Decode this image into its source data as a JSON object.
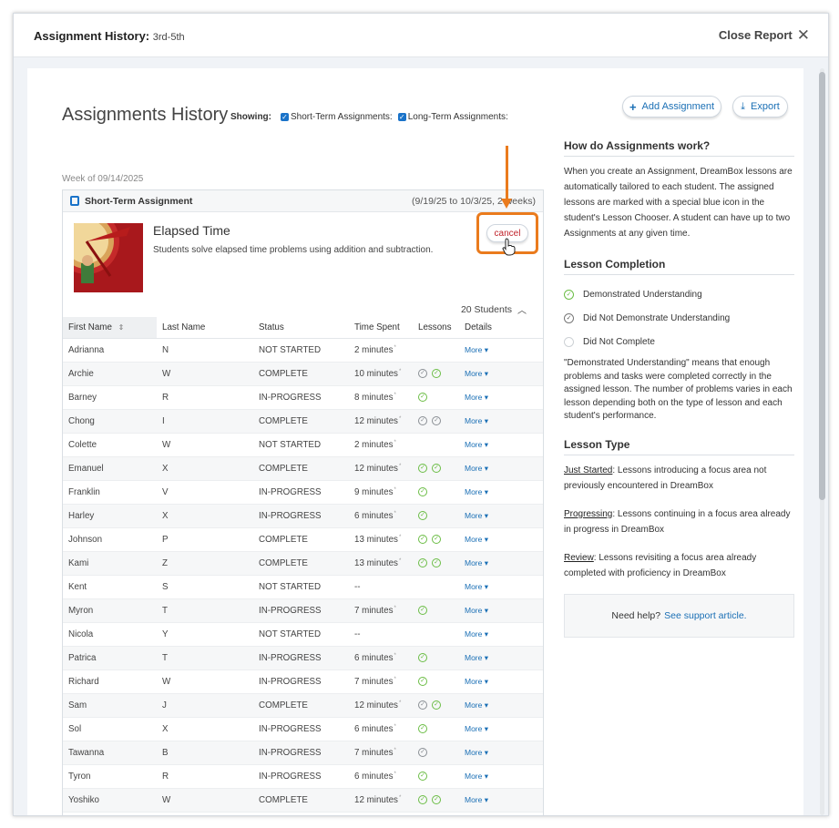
{
  "topbar": {
    "title": "Assignment History:",
    "grade": "3rd-5th",
    "close_label": "Close Report"
  },
  "header": {
    "page_title": "Assignments History",
    "showing_label": "Showing:",
    "short_term_label": "Short-Term Assignments:",
    "long_term_label": "Long-Term Assignments:",
    "short_term_checked": true,
    "long_term_checked": true,
    "add_assignment_label": "Add Assignment",
    "export_label": "Export"
  },
  "week_label": "Week of 09/14/2025",
  "assignment": {
    "type_label": "Short-Term Assignment",
    "date_range": "(9/19/25 to 10/3/25, 2 weeks)",
    "lesson_title": "Elapsed Time",
    "lesson_description": "Students solve elapsed time problems using addition and subtraction.",
    "cancel_label": "cancel",
    "students_count": "20 Students"
  },
  "table": {
    "headers": [
      "First Name",
      "Last Name",
      "Status",
      "Time Spent",
      "Lessons",
      "Details"
    ],
    "more_label": "More",
    "rows": [
      {
        "first": "Adrianna",
        "last": "N",
        "status": "NOT STARTED",
        "time": "2 minutes",
        "lessons": []
      },
      {
        "first": "Archie",
        "last": "W",
        "status": "COMPLETE",
        "time": "10 minutes",
        "lessons": [
          "gray",
          "green"
        ]
      },
      {
        "first": "Barney",
        "last": "R",
        "status": "IN-PROGRESS",
        "time": "8 minutes",
        "lessons": [
          "green"
        ]
      },
      {
        "first": "Chong",
        "last": "I",
        "status": "COMPLETE",
        "time": "12 minutes",
        "lessons": [
          "gray",
          "gray"
        ]
      },
      {
        "first": "Colette",
        "last": "W",
        "status": "NOT STARTED",
        "time": "2 minutes",
        "lessons": []
      },
      {
        "first": "Emanuel",
        "last": "X",
        "status": "COMPLETE",
        "time": "12 minutes",
        "lessons": [
          "green",
          "green"
        ]
      },
      {
        "first": "Franklin",
        "last": "V",
        "status": "IN-PROGRESS",
        "time": "9 minutes",
        "lessons": [
          "green"
        ]
      },
      {
        "first": "Harley",
        "last": "X",
        "status": "IN-PROGRESS",
        "time": "6 minutes",
        "lessons": [
          "green"
        ]
      },
      {
        "first": "Johnson",
        "last": "P",
        "status": "COMPLETE",
        "time": "13 minutes",
        "lessons": [
          "green",
          "green"
        ]
      },
      {
        "first": "Kami",
        "last": "Z",
        "status": "COMPLETE",
        "time": "13 minutes",
        "lessons": [
          "green",
          "green"
        ]
      },
      {
        "first": "Kent",
        "last": "S",
        "status": "NOT STARTED",
        "time": "--",
        "lessons": []
      },
      {
        "first": "Myron",
        "last": "T",
        "status": "IN-PROGRESS",
        "time": "7 minutes",
        "lessons": [
          "green"
        ]
      },
      {
        "first": "Nicola",
        "last": "Y",
        "status": "NOT STARTED",
        "time": "--",
        "lessons": []
      },
      {
        "first": "Patrica",
        "last": "T",
        "status": "IN-PROGRESS",
        "time": "6 minutes",
        "lessons": [
          "green"
        ]
      },
      {
        "first": "Richard",
        "last": "W",
        "status": "IN-PROGRESS",
        "time": "7 minutes",
        "lessons": [
          "green"
        ]
      },
      {
        "first": "Sam",
        "last": "J",
        "status": "COMPLETE",
        "time": "12 minutes",
        "lessons": [
          "gray",
          "green"
        ]
      },
      {
        "first": "Sol",
        "last": "X",
        "status": "IN-PROGRESS",
        "time": "6 minutes",
        "lessons": [
          "green"
        ]
      },
      {
        "first": "Tawanna",
        "last": "B",
        "status": "IN-PROGRESS",
        "time": "7 minutes",
        "lessons": [
          "gray"
        ]
      },
      {
        "first": "Tyron",
        "last": "R",
        "status": "IN-PROGRESS",
        "time": "6 minutes",
        "lessons": [
          "green"
        ]
      },
      {
        "first": "Yoshiko",
        "last": "W",
        "status": "COMPLETE",
        "time": "12 minutes",
        "lessons": [
          "green",
          "green"
        ]
      }
    ]
  },
  "sidebar": {
    "how_title": "How do Assignments work?",
    "how_text": "When you create an Assignment, DreamBox lessons are automatically tailored to each student. The assigned lessons are marked with a special blue icon in the student's Lesson Chooser. A student can have up to two Assignments at any given time.",
    "completion_title": "Lesson Completion",
    "completion_items": [
      "Demonstrated Understanding",
      "Did Not Demonstrate Understanding",
      "Did Not Complete"
    ],
    "completion_note": "\"Demonstrated Understanding\" means that enough problems and tasks were completed correctly in the assigned lesson. The number of problems varies in each lesson depending both on the type of lesson and each student's performance.",
    "type_title": "Lesson Type",
    "types": [
      {
        "name": "Just Started",
        "desc": ": Lessons introducing a focus area not previously encountered in DreamBox"
      },
      {
        "name": "Progressing",
        "desc": ": Lessons continuing in a focus area already in progress in DreamBox"
      },
      {
        "name": "Review",
        "desc": ": Lessons revisiting a focus area already completed with proficiency in DreamBox"
      }
    ],
    "help_text": "Need help?",
    "help_link": "See support article."
  },
  "colors": {
    "accent_blue": "#1a6fb5",
    "highlight_orange": "#ea7b1d",
    "cancel_red": "#c0222a",
    "check_green": "#6bbd45"
  },
  "icons": [
    "close-icon",
    "plus-icon",
    "download-icon",
    "assignment-icon",
    "sort-icon",
    "chevron-up-icon",
    "check-circle-icon",
    "chevron-down-icon",
    "hand-cursor-icon"
  ]
}
